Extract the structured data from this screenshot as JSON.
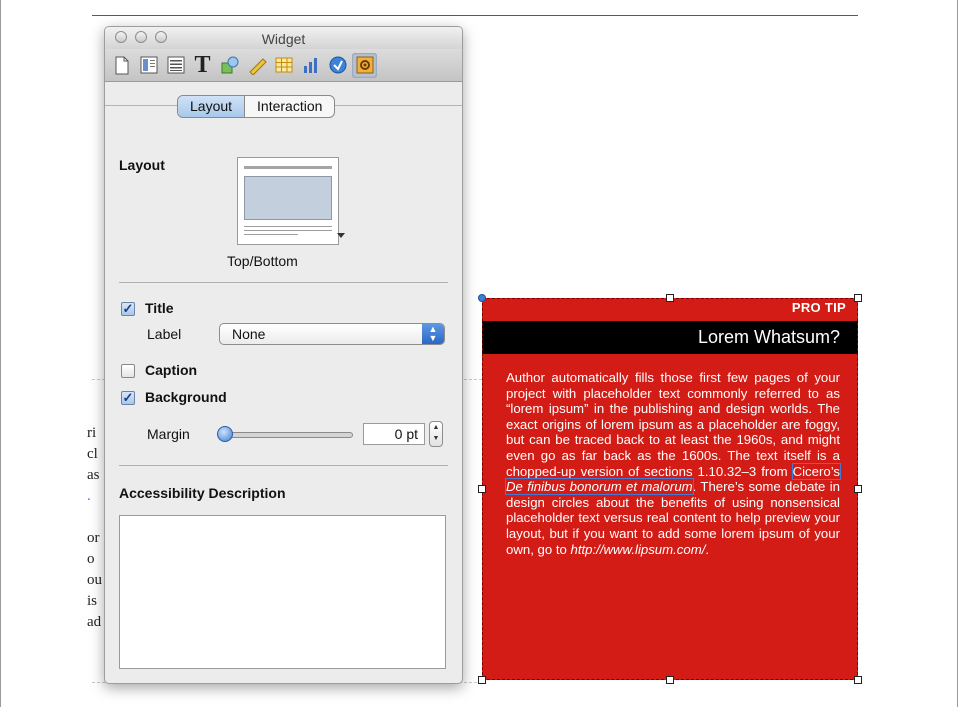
{
  "window": {
    "title": "Widget"
  },
  "toolbar": {
    "items": [
      {
        "icon": "document-icon"
      },
      {
        "icon": "layout-icon"
      },
      {
        "icon": "text-columns-icon"
      },
      {
        "icon": "text-icon",
        "glyph": "T"
      },
      {
        "icon": "shapes-icon"
      },
      {
        "icon": "ruler-icon"
      },
      {
        "icon": "table-icon"
      },
      {
        "icon": "chart-icon"
      },
      {
        "icon": "interaction-icon"
      },
      {
        "icon": "widget-settings-icon",
        "active": true
      }
    ]
  },
  "tabs": {
    "layout": "Layout",
    "interaction": "Interaction",
    "selected": "Layout"
  },
  "layout_section": {
    "heading": "Layout",
    "selected_layout": "Top/Bottom"
  },
  "options": {
    "title_label": "Title",
    "title_checked": true,
    "label_label": "Label",
    "label_value": "None",
    "caption_label": "Caption",
    "caption_checked": false,
    "background_label": "Background",
    "background_checked": true,
    "margin_label": "Margin",
    "margin_value": "0 pt",
    "margin_slider_fraction": 0.0
  },
  "accessibility": {
    "heading": "Accessibility Description",
    "value": ""
  },
  "background_text": {
    "glyphs": [
      "ri",
      "cl",
      "as",
      ".",
      "or",
      "o",
      "ou",
      "is",
      "ad"
    ]
  },
  "protip": {
    "label": "PRO TIP",
    "title": "Lorem Whatsum?",
    "body_1": "Author automatically fills those first few pages of your project with placeholder text commonly referred to as “lorem ipsum” in the publishing and design worlds. The exact origins of lorem ipsum as a placeholder are foggy, but can be traced back to at least the 1960s, and might even go as far back as the 1600s. The text itself is a chopped-up version of sections 1.10.32–3 from ",
    "link_1": "Cicero’s",
    "link_2": "De finibus bonorum et malorum",
    "body_2": ". There’s some debate in design circles about the benefits of using nonsensical placeholder text versus real content to help preview your layout, but if you want to add some lorem ipsum of your own, go to ",
    "url": "http://www.lipsum.com/",
    "url_suffix": ".",
    "colors": {
      "background": "#d41c16",
      "header": "#000000",
      "text": "#ffffff"
    }
  }
}
